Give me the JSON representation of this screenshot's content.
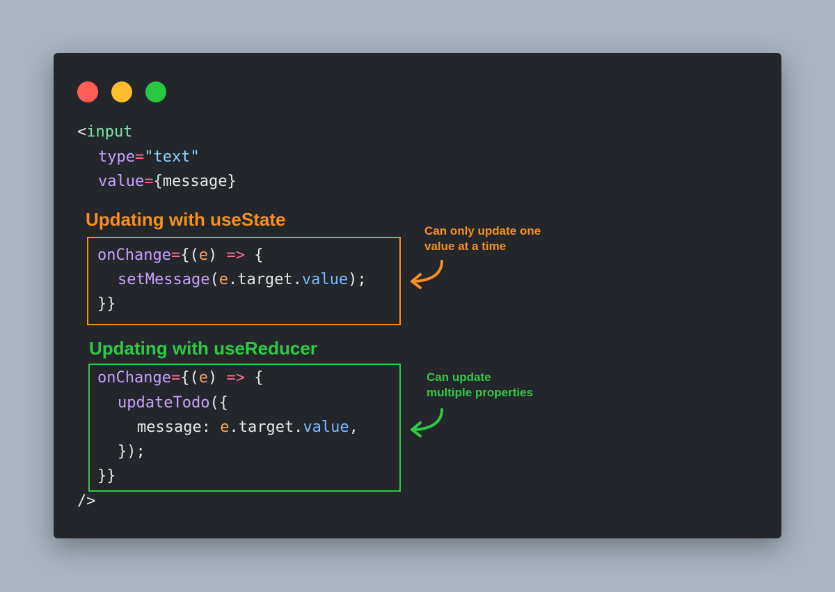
{
  "window": {
    "controls": [
      "close",
      "minimize",
      "maximize"
    ],
    "colors": {
      "close": "#ff5f57",
      "minimize": "#febc2e",
      "maximize": "#28c840",
      "background": "#23272c"
    }
  },
  "code": {
    "open_tag_bracket": "<",
    "tag_name": "input",
    "type_attr": "type",
    "type_eq": "=",
    "type_value": "\"text\"",
    "value_attr": "value",
    "value_eq": "=",
    "value_expr": "{message}",
    "close_tag": "/>"
  },
  "use_state": {
    "title": "Updating with useState",
    "color": "#f7901e",
    "note_lines": [
      "Can only update one",
      "value at a time"
    ],
    "line1": {
      "attr": "onChange",
      "eq": "=",
      "open": "{(",
      "param": "e",
      "close_paren": ")",
      "space": " ",
      "arrow": "=>",
      "brace": " {"
    },
    "line2": {
      "fn": "setMessage",
      "open": "(",
      "param": "e",
      "mid": ".target.",
      "prop": "value",
      "end": ");"
    },
    "line3": "}}"
  },
  "use_reducer": {
    "title": "Updating with useReducer",
    "color": "#2fca45",
    "note_lines": [
      "Can update",
      "multiple properties"
    ],
    "line1": {
      "attr": "onChange",
      "eq": "=",
      "open": "{(",
      "param": "e",
      "close_paren": ")",
      "space": " ",
      "arrow": "=>",
      "brace": " {"
    },
    "line2": {
      "fn": "updateTodo",
      "open": "({"
    },
    "line3": {
      "key": "message: ",
      "param": "e",
      "mid": ".target.",
      "prop": "value",
      "end": ","
    },
    "line4": "});",
    "line5": "}}"
  }
}
